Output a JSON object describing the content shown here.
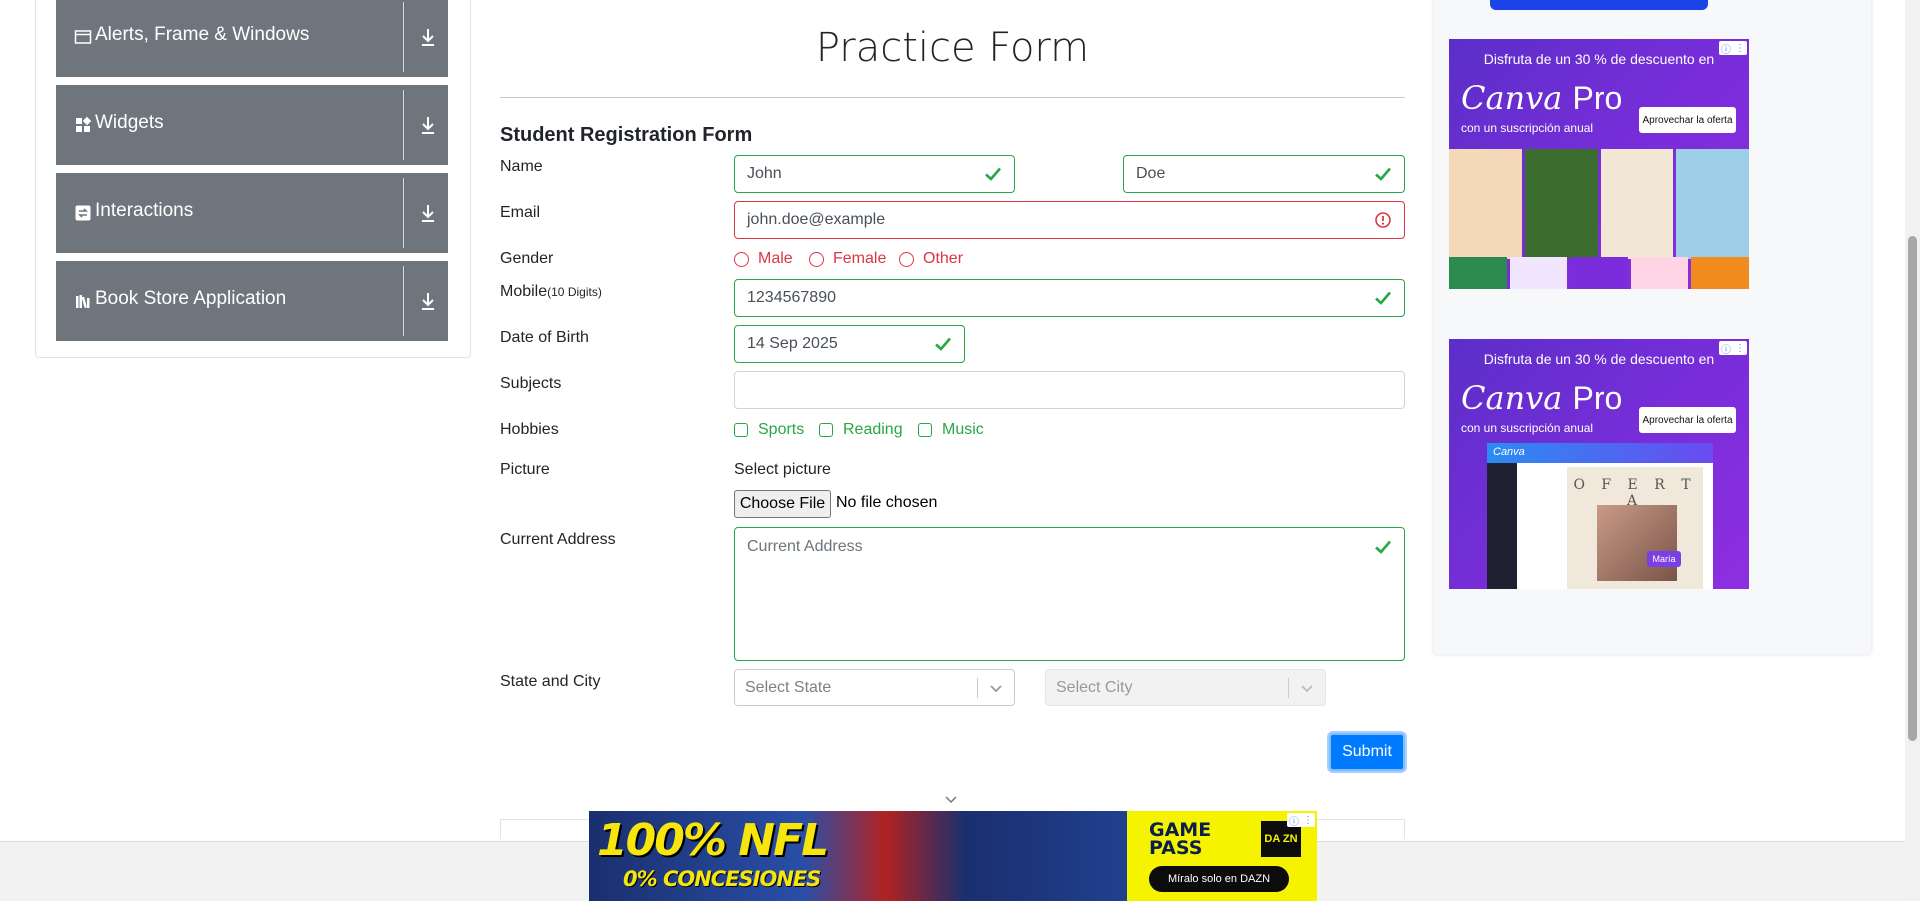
{
  "sidebar": {
    "groups": [
      {
        "label": "Alerts, Frame & Windows",
        "icon": "window-icon"
      },
      {
        "label": "Widgets",
        "icon": "widgets-icon"
      },
      {
        "label": "Interactions",
        "icon": "interactions-icon"
      },
      {
        "label": "Book Store Application",
        "icon": "books-icon"
      }
    ]
  },
  "form": {
    "title": "Practice Form",
    "subtitle": "Student Registration Form",
    "labels": {
      "name": "Name",
      "email": "Email",
      "gender": "Gender",
      "mobile": "Mobile",
      "mobile_hint": "(10 Digits)",
      "dob": "Date of Birth",
      "subjects": "Subjects",
      "hobbies": "Hobbies",
      "picture": "Picture",
      "address": "Current Address",
      "state_city": "State and City"
    },
    "first_name": "John",
    "last_name": "Doe",
    "email": "john.doe@example",
    "gender_options": [
      "Male",
      "Female",
      "Other"
    ],
    "mobile": "1234567890",
    "dob": "14 Sep 2025",
    "subjects": "",
    "hobby_options": [
      "Sports",
      "Reading",
      "Music"
    ],
    "picture_label": "Select picture",
    "file_button": "Choose File",
    "file_status": "No file chosen",
    "address_placeholder": "Current Address",
    "state_placeholder": "Select State",
    "city_placeholder": "Select City",
    "submit": "Submit"
  },
  "ads": {
    "canva": {
      "headline": "Disfruta de un 30 % de descuento en",
      "brand": "Canva",
      "brand_suffix": "Pro",
      "sub": "con un suscripción anual",
      "cta": "Aprovechar la oferta",
      "tag": "María",
      "oferta": "O F E R T A",
      "app_name": "Canva"
    },
    "nfl": {
      "headline": "100% NFL",
      "sub": "0% CONCESIONES",
      "game_pass": "GAME PASS",
      "dazn": "DA ZN",
      "cta": "Míralo solo en DAZN"
    }
  },
  "colors": {
    "valid": "#28a745",
    "invalid": "#dc3545",
    "primary": "#007bff",
    "sidebar_group": "#6e757c"
  }
}
